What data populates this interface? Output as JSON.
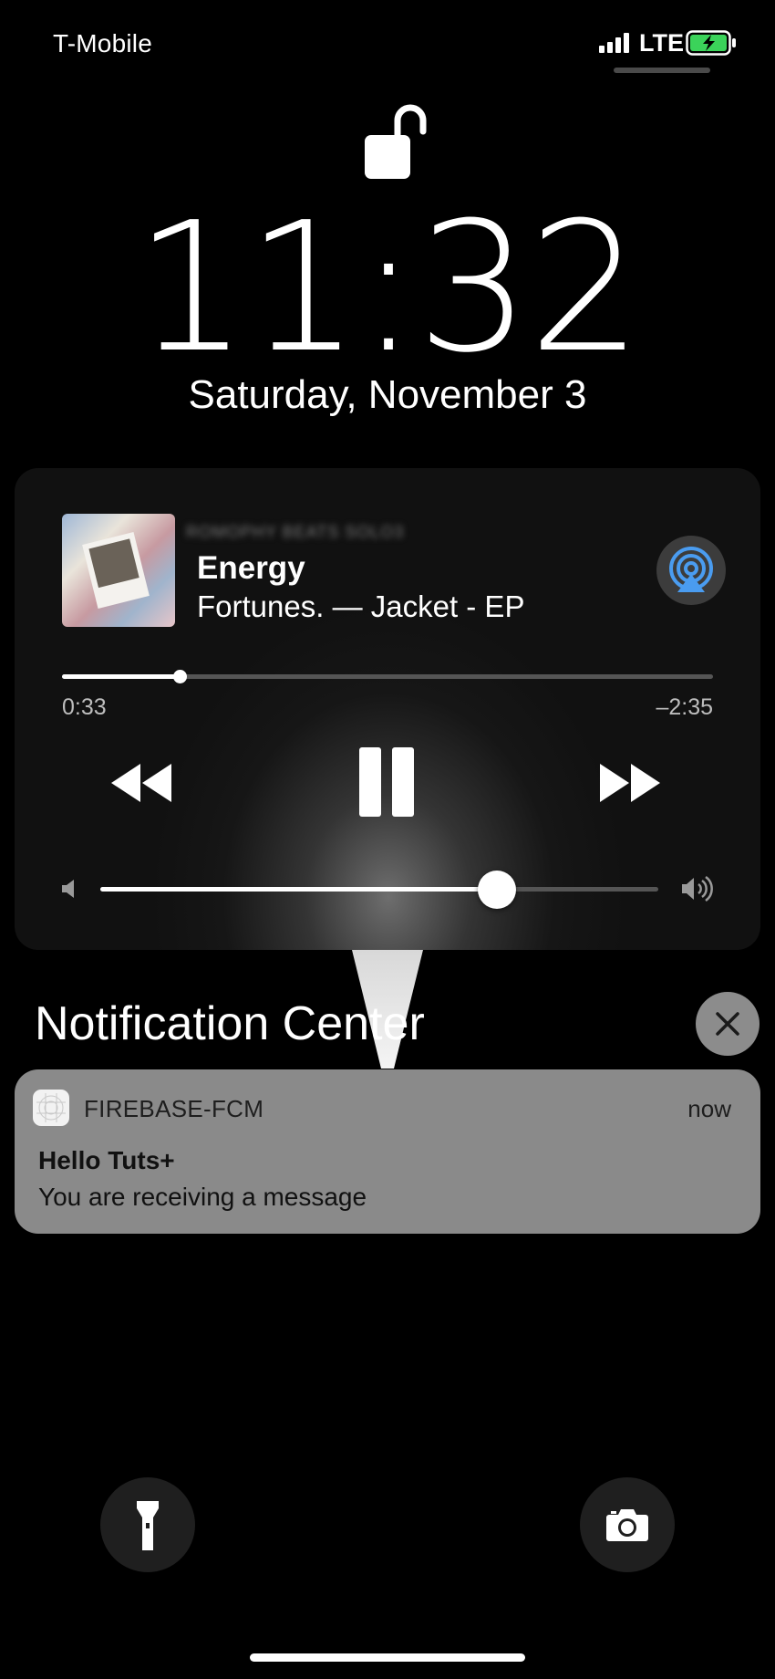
{
  "status_bar": {
    "carrier": "T-Mobile",
    "network": "LTE",
    "signal_icon": "signal-bars-icon",
    "battery_icon": "battery-charging-icon",
    "battery_color": "#3bd35a"
  },
  "lock_screen": {
    "lock_icon": "unlocked-padlock-icon",
    "time": "11:32",
    "date": "Saturday, November 3"
  },
  "now_playing": {
    "source": "ROMOPHY BEATS SOLO3",
    "song": "Energy",
    "artist_album": "Fortunes. — Jacket - EP",
    "airplay_icon": "airplay-audio-icon",
    "airplay_color": "#4a9cf0",
    "elapsed": "0:33",
    "remaining": "–2:35",
    "progress_fraction": 0.18,
    "volume_fraction": 0.71,
    "controls": {
      "rewind_icon": "rewind-icon",
      "pause_icon": "pause-icon",
      "forward_icon": "fast-forward-icon"
    }
  },
  "notification_center": {
    "title": "Notification Center",
    "clear_icon": "close-icon",
    "notifications": [
      {
        "app": "FIREBASE-FCM",
        "time": "now",
        "title": "Hello Tuts+",
        "body": "You are receiving a message"
      }
    ]
  },
  "quick_actions": {
    "flashlight_icon": "flashlight-icon",
    "camera_icon": "camera-icon"
  }
}
